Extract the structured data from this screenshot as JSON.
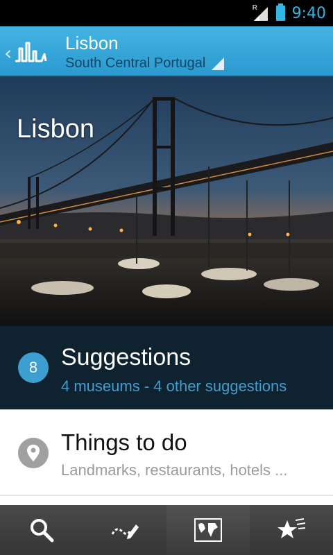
{
  "status_bar": {
    "time": "9:40",
    "roaming": "R"
  },
  "action_bar": {
    "title": "Lisbon",
    "subtitle": "South Central Portugal"
  },
  "hero": {
    "title": "Lisbon"
  },
  "suggestions": {
    "count": "8",
    "title": "Suggestions",
    "subtitle": "4 museums - 4 other suggestions"
  },
  "things_to_do": {
    "title": "Things to do",
    "subtitle": "Landmarks, restaurants, hotels ..."
  },
  "toolbar": {
    "icons": [
      "search-icon",
      "route-edit-icon",
      "map-icon",
      "favorites-icon"
    ],
    "active_index": 2
  },
  "colors": {
    "accent": "#33b5e5",
    "actionbar": "#2fa3d8",
    "suggestions_bg": "#0f2230",
    "toolbar_bg": "#3f3f3f"
  }
}
